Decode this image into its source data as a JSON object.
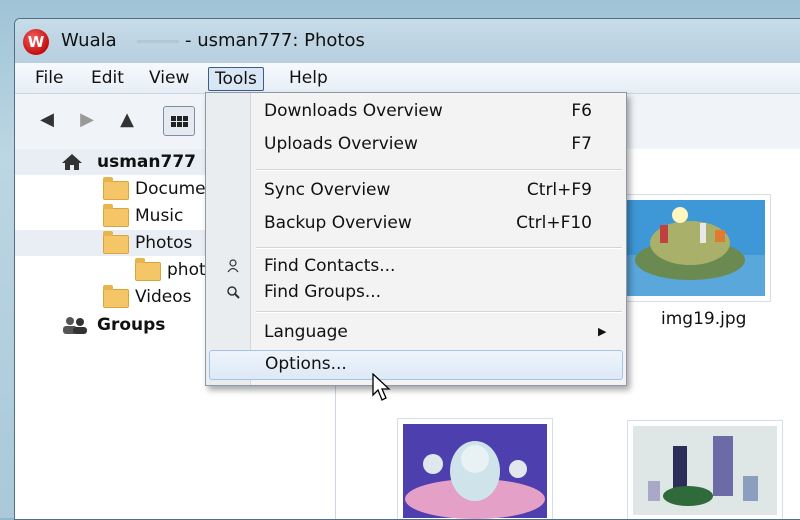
{
  "window": {
    "logo_letter": "W",
    "app_name": "Wuala",
    "title": "- usman777: Photos"
  },
  "menubar": {
    "items": [
      {
        "label": "File"
      },
      {
        "label": "Edit"
      },
      {
        "label": "View"
      },
      {
        "label": "Tools"
      },
      {
        "label": "Help"
      }
    ]
  },
  "toolbar": {
    "back_icon": "◀",
    "forward_icon": "▶",
    "up_icon": "▲"
  },
  "sidebar": {
    "root": "usman777",
    "folders": [
      {
        "label": "Docume"
      },
      {
        "label": "Music"
      },
      {
        "label": "Photos"
      },
      {
        "label": "phot"
      },
      {
        "label": "Videos"
      }
    ],
    "groups": "Groups"
  },
  "content": {
    "thumb_caption": "img19.jpg"
  },
  "tools_menu": {
    "items": [
      {
        "label": "Downloads Overview",
        "shortcut": "F6"
      },
      {
        "label": "Uploads Overview",
        "shortcut": "F7"
      },
      {
        "label": "Sync Overview",
        "shortcut": "Ctrl+F9"
      },
      {
        "label": "Backup Overview",
        "shortcut": "Ctrl+F10"
      },
      {
        "label": "Find Contacts...",
        "shortcut": ""
      },
      {
        "label": "Find Groups...",
        "shortcut": ""
      },
      {
        "label": "Language",
        "shortcut": ""
      },
      {
        "label": "Options...",
        "shortcut": ""
      }
    ],
    "submenu_arrow": "▶"
  },
  "colors": {
    "accent": "#c40e0e",
    "selection": "#dde9f6"
  }
}
